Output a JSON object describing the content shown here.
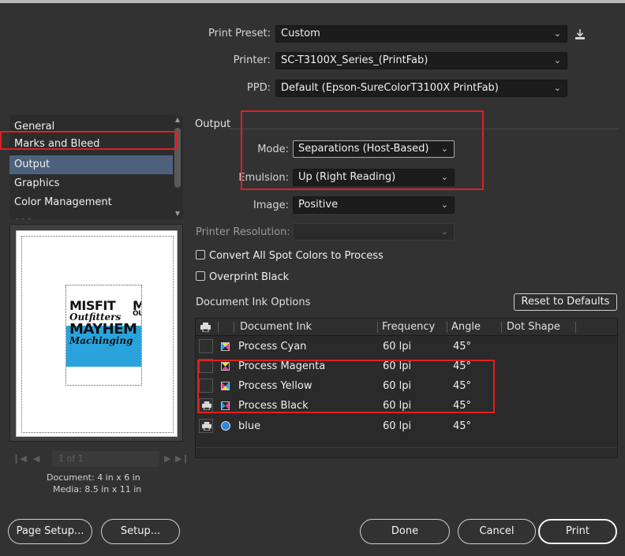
{
  "presets": {
    "print_preset_label": "Print Preset:",
    "print_preset_value": "Custom",
    "printer_label": "Printer:",
    "printer_value": "SC-T3100X_Series_(PrintFab)",
    "ppd_label": "PPD:",
    "ppd_value": "Default (Epson-SureColorT3100X PrintFab)"
  },
  "sidebar": {
    "items": [
      {
        "label": "General"
      },
      {
        "label": "Marks and Bleed"
      },
      {
        "label": "Output"
      },
      {
        "label": "Graphics"
      },
      {
        "label": "Color Management"
      }
    ],
    "selected_index": 2
  },
  "preview": {
    "art_lines": [
      "MISFIT",
      "Outfitters",
      "MAYHEM",
      "Machinging"
    ],
    "page_indicator": "1 of 1",
    "document_size": "Document: 4 in x 6 in",
    "media_size": "Media: 8.5 in x 11 in"
  },
  "output": {
    "section_title": "Output",
    "mode_label": "Mode:",
    "mode_value": "Separations (Host-Based)",
    "emulsion_label": "Emulsion:",
    "emulsion_value": "Up (Right Reading)",
    "image_label": "Image:",
    "image_value": "Positive",
    "printer_resolution_label": "Printer Resolution:",
    "printer_resolution_value": "",
    "convert_spot_label": "Convert All Spot Colors to Process",
    "convert_spot_checked": false,
    "overprint_black_label": "Overprint Black",
    "overprint_black_checked": false
  },
  "ink_options": {
    "title": "Document Ink Options",
    "reset_button": "Reset to Defaults",
    "columns": [
      "Document Ink",
      "Frequency",
      "Angle",
      "Dot Shape"
    ],
    "rows": [
      {
        "ink": "Process Cyan",
        "frequency": "60 lpi",
        "angle": "45°",
        "dot_shape": "",
        "print": false,
        "icon": "process-cyan-icon"
      },
      {
        "ink": "Process Magenta",
        "frequency": "60 lpi",
        "angle": "45°",
        "dot_shape": "",
        "print": false,
        "icon": "process-magenta-icon"
      },
      {
        "ink": "Process Yellow",
        "frequency": "60 lpi",
        "angle": "45°",
        "dot_shape": "",
        "print": false,
        "icon": "process-yellow-icon"
      },
      {
        "ink": "Process Black",
        "frequency": "60 lpi",
        "angle": "45°",
        "dot_shape": "",
        "print": true,
        "icon": "process-black-icon"
      },
      {
        "ink": "blue",
        "frequency": "60 lpi",
        "angle": "45°",
        "dot_shape": "",
        "print": true,
        "icon": "spot-color-icon"
      }
    ]
  },
  "footer": {
    "page_setup": "Page Setup...",
    "setup": "Setup...",
    "done": "Done",
    "cancel": "Cancel",
    "print": "Print"
  },
  "colors": {
    "background": "#323232",
    "selection": "#4e617c",
    "highlight_box": "#e02020",
    "spot_blue": "#2aa3dc"
  }
}
